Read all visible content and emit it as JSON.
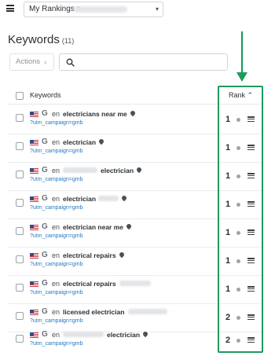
{
  "topbar": {
    "project_label": "My Rankings >",
    "caret": "▾"
  },
  "page": {
    "title": "Keywords",
    "count": "(11)"
  },
  "toolbar": {
    "actions_label": "Actions",
    "actions_chevron": "›",
    "search_placeholder": ""
  },
  "table": {
    "header_keywords": "Keywords",
    "header_rank": "Rank ⌃"
  },
  "rows": [
    {
      "lang": "en",
      "pre": "",
      "keyword": "electricians near me",
      "suffix": "",
      "link": "?utm_campaign=gmb",
      "rank": "1"
    },
    {
      "lang": "en",
      "pre": "",
      "keyword": "electrician",
      "suffix": "",
      "link": "?utm_campaign=gmb",
      "rank": "1"
    },
    {
      "lang": "en",
      "pre": "",
      "keyword": "electrician",
      "suffix": "",
      "link": "?utm_campaign=gmb",
      "rank": "1"
    },
    {
      "lang": "en",
      "pre": "",
      "keyword": "electrician",
      "suffix": "",
      "link": "?utm_campaign=gmb",
      "rank": "1"
    },
    {
      "lang": "en",
      "pre": "",
      "keyword": "electrician near me",
      "suffix": "",
      "link": "?utm_campaign=gmb",
      "rank": "1"
    },
    {
      "lang": "en",
      "pre": "",
      "keyword": "electrical repairs",
      "suffix": "",
      "link": "?utm_campaign=gmb",
      "rank": "1"
    },
    {
      "lang": "en",
      "pre": "",
      "keyword": "electrical repairs",
      "suffix": "",
      "link": "?utm_campaign=gmb",
      "rank": "1"
    },
    {
      "lang": "en",
      "pre": "",
      "keyword": "licensed electrician",
      "suffix": "",
      "link": "?utm_campaign=gmb",
      "rank": "2"
    },
    {
      "lang": "en",
      "pre": "",
      "keyword": "electrician",
      "suffix": "",
      "link": "?utm_campaign=gmb",
      "rank": "2"
    }
  ],
  "annotation": {
    "color": "#1e9a5c"
  }
}
